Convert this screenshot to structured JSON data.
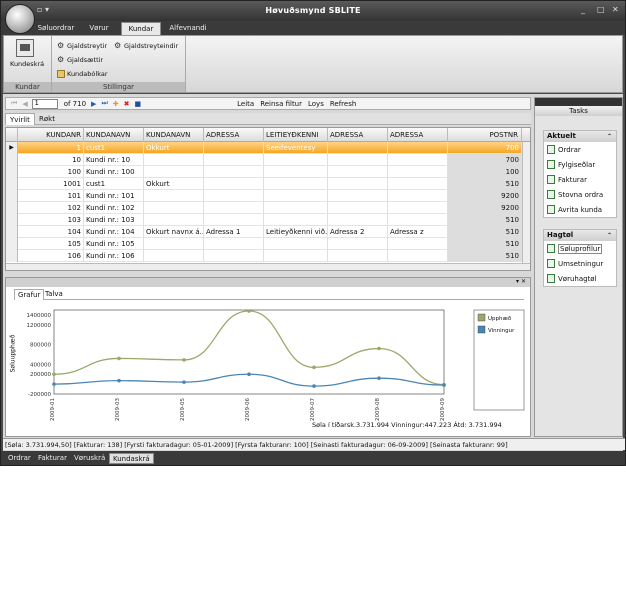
{
  "window": {
    "title": "Høvuðsmynd SBLITE",
    "qat": "▫ ▾",
    "min": "_",
    "max": "□",
    "close": "✕"
  },
  "ribbon": {
    "tabs": [
      {
        "label": "Søluordrar"
      },
      {
        "label": "Vørur"
      },
      {
        "label": "Kundar"
      },
      {
        "label": "Alfevnandi"
      }
    ],
    "kundar_group": {
      "label": "Kundar",
      "button": "Kundeskrá"
    },
    "stillingar_group": {
      "label": "Stillingar",
      "items": [
        "Gjaldstreytir",
        "Gjaldstreyteindir",
        "Gjaldsættir",
        "Kundabólkar"
      ]
    }
  },
  "navigator": {
    "first": "⏮",
    "prev": "◀",
    "position": "1",
    "of": "of 710",
    "next": "▶",
    "last": "⏭",
    "add": "✚",
    "delete": "✖",
    "save": "■",
    "search": "Leita",
    "clear_filter": "Reinsa filtur",
    "save_label": "Loys",
    "refresh": "Refresh"
  },
  "subtabs": [
    "Yvirlit",
    "Røkt"
  ],
  "grid": {
    "columns": [
      "KUNDANR",
      "KUNDANAVN",
      "KUNDANAVN",
      "ADRESSA",
      "LEITIEYÐKENNI",
      "ADRESSA",
      "ADRESSA",
      "POSTNR"
    ],
    "rows": [
      [
        "1",
        "cust1",
        "Okkurt",
        "",
        "Seeifeventesy",
        "",
        "",
        "700"
      ],
      [
        "10",
        "Kundi nr.: 10",
        "",
        "",
        "",
        "",
        "",
        "700"
      ],
      [
        "100",
        "Kundi nr.: 100",
        "",
        "",
        "",
        "",
        "",
        "100"
      ],
      [
        "1001",
        "cust1",
        "Okkurt",
        "",
        "",
        "",
        "",
        "510"
      ],
      [
        "101",
        "Kundi nr.: 101",
        "",
        "",
        "",
        "",
        "",
        "9200"
      ],
      [
        "102",
        "Kundi nr.: 102",
        "",
        "",
        "",
        "",
        "",
        "9200"
      ],
      [
        "103",
        "Kundi nr.: 103",
        "",
        "",
        "",
        "",
        "",
        "510"
      ],
      [
        "104",
        "Kundi nr.: 104",
        "Okkurt navnx á...",
        "Adressa 1",
        "Leitieyðkenni við...",
        "Adressa 2",
        "Adressa z",
        "510"
      ],
      [
        "105",
        "Kundi nr.: 105",
        "",
        "",
        "",
        "",
        "",
        "510"
      ],
      [
        "106",
        "Kundi nr.: 106",
        "",
        "",
        "",
        "",
        "",
        "510"
      ]
    ]
  },
  "chart_panel": {
    "tabs": [
      "Grafur",
      "Talva"
    ],
    "pin": "▾ ✕",
    "ylabel": "Søluupphæð",
    "summary": "Søla í tíðarsk.3.731.994 Vinningur:447.223 Átd: 3.731.994"
  },
  "chart_data": {
    "type": "line",
    "x": [
      "2009-01",
      "2009-03",
      "2009-05",
      "2009-06",
      "2009-07",
      "2009-08",
      "2009-09"
    ],
    "yticks": [
      "1400000",
      "1200000",
      "800000",
      "400000",
      "200000",
      "-200000"
    ],
    "ylim": [
      -200000,
      1500000
    ],
    "series": [
      {
        "name": "Upphæð",
        "color": "#9aa96a",
        "values": [
          200000,
          520000,
          490000,
          1480000,
          340000,
          720000,
          -10000
        ]
      },
      {
        "name": "Vinningur",
        "color": "#4a86b4",
        "values": [
          0,
          70000,
          40000,
          200000,
          -40000,
          120000,
          -20000
        ]
      }
    ],
    "legend": "right"
  },
  "tasks": {
    "title": "Tasks",
    "aktuelt": {
      "label": "Aktuelt",
      "items": [
        "Ordrar",
        "Fylgiseðlar",
        "Fakturar",
        "Stovna ordra",
        "Avrita kunda"
      ]
    },
    "hagtol": {
      "label": "Hagtøl",
      "items": [
        "Søluprofilur",
        "Umsetningur",
        "Vøruhagtøl"
      ]
    }
  },
  "status": "[Søla: 3.731.994,50] [Fakturar: 138] [Fyrsti fakturadagur: 05-01-2009] [Fyrsta fakturanr: 100] [Seinasti fakturadagur: 06-09-2009] [Seinasta fakturanr: 99]",
  "bottom_tabs": [
    {
      "label": "Ordrar"
    },
    {
      "label": "Fakturar"
    },
    {
      "label": "Vøruskrá"
    },
    {
      "label": "Kundaskrá"
    }
  ]
}
